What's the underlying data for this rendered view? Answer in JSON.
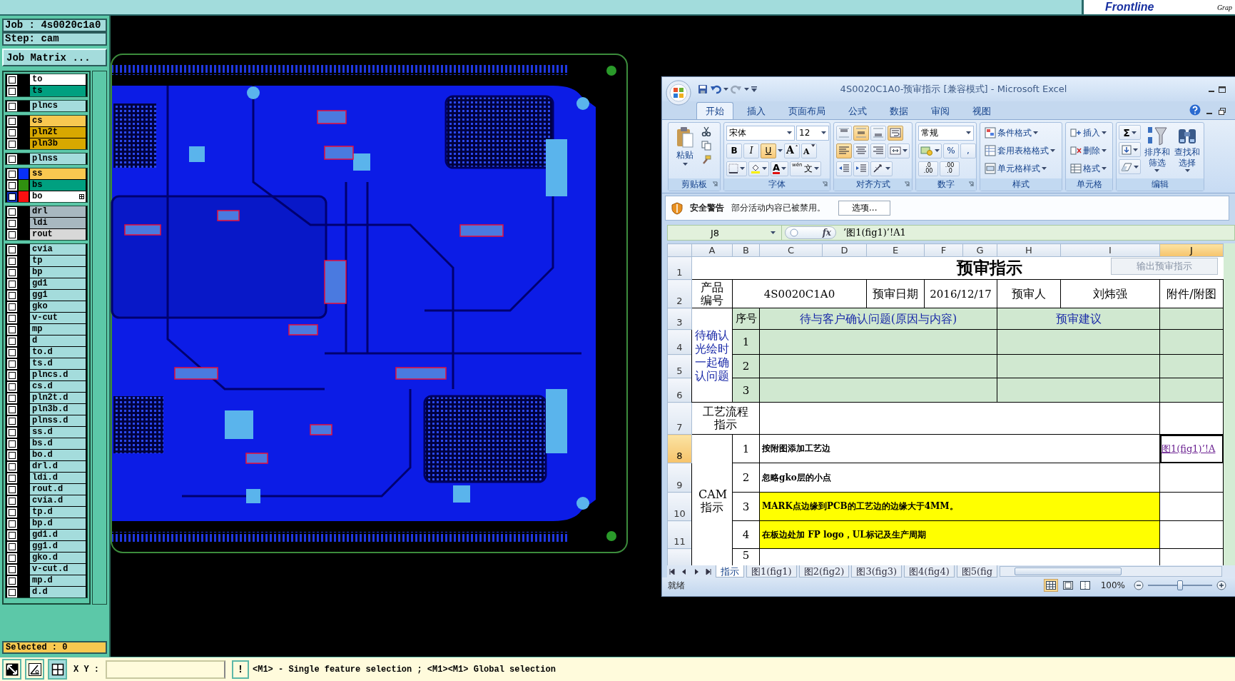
{
  "top_bar": {
    "logo": "Frontline",
    "logo_sub": "Grap"
  },
  "job_panel": {
    "job": "Job : 4s0020c1a0",
    "step": "Step: cam",
    "matrix_button": "Job Matrix ...",
    "selected_count": "Selected : 0"
  },
  "layer_groups": [
    {
      "layers": [
        {
          "name": "to",
          "color": "#ffffff",
          "checked": false,
          "selected": false
        },
        {
          "name": "ts",
          "color": "#00a080",
          "checked": false,
          "selected": false
        }
      ]
    },
    {
      "layers": [
        {
          "name": "plncs",
          "color": "#a4dcdc",
          "checked": false,
          "selected": false
        }
      ]
    },
    {
      "layers": [
        {
          "name": "cs",
          "color": "#f8c850",
          "checked": false,
          "selected": false
        },
        {
          "name": "pln2t",
          "color": "#d8a800",
          "checked": false,
          "selected": false
        },
        {
          "name": "pln3b",
          "color": "#d8a800",
          "checked": false,
          "selected": false
        }
      ]
    },
    {
      "layers": [
        {
          "name": "plnss",
          "color": "#a4dcdc",
          "checked": false,
          "selected": false
        }
      ]
    },
    {
      "layers": [
        {
          "name": "ss",
          "color": "#f8c850",
          "checked": false,
          "selected": false,
          "swatch": {
            "color": "#0830f8"
          }
        },
        {
          "name": "bs",
          "color": "#00a080",
          "checked": false,
          "selected": false,
          "swatch": {
            "color": "#309010"
          }
        },
        {
          "name": "bo",
          "color": "#ffffff",
          "checked": false,
          "selected": true,
          "swatch": {
            "color": "#f81010"
          }
        }
      ]
    },
    {
      "layers": [
        {
          "name": "drl",
          "color": "#a8b8c0",
          "checked": false,
          "selected": false
        },
        {
          "name": "ldi",
          "color": "#a8b8c0",
          "checked": false,
          "selected": false
        },
        {
          "name": "rout",
          "color": "#d8d8d8",
          "checked": false,
          "selected": false
        }
      ]
    },
    {
      "layers": [
        {
          "name": "cvia",
          "color": "#a4dcdc",
          "checked": false,
          "selected": false
        },
        {
          "name": "tp",
          "color": "#a4dcdc",
          "checked": false,
          "selected": false
        },
        {
          "name": "bp",
          "color": "#a4dcdc",
          "checked": false,
          "selected": false
        },
        {
          "name": "gd1",
          "color": "#a4dcdc",
          "checked": false,
          "selected": false
        },
        {
          "name": "gg1",
          "color": "#a4dcdc",
          "checked": false,
          "selected": false
        },
        {
          "name": "gko",
          "color": "#a4dcdc",
          "checked": false,
          "selected": false
        },
        {
          "name": "v-cut",
          "color": "#a4dcdc",
          "checked": false,
          "selected": false
        },
        {
          "name": "mp",
          "color": "#a4dcdc",
          "checked": false,
          "selected": false
        },
        {
          "name": "d",
          "color": "#a4dcdc",
          "checked": false,
          "selected": false
        },
        {
          "name": "to.d",
          "color": "#a4dcdc",
          "checked": false,
          "selected": false
        },
        {
          "name": "ts.d",
          "color": "#a4dcdc",
          "checked": false,
          "selected": false
        },
        {
          "name": "plncs.d",
          "color": "#a4dcdc",
          "checked": false,
          "selected": false
        },
        {
          "name": "cs.d",
          "color": "#a4dcdc",
          "checked": false,
          "selected": false
        },
        {
          "name": "pln2t.d",
          "color": "#a4dcdc",
          "checked": false,
          "selected": false
        },
        {
          "name": "pln3b.d",
          "color": "#a4dcdc",
          "checked": false,
          "selected": false
        },
        {
          "name": "plnss.d",
          "color": "#a4dcdc",
          "checked": false,
          "selected": false
        },
        {
          "name": "ss.d",
          "color": "#a4dcdc",
          "checked": false,
          "selected": false
        },
        {
          "name": "bs.d",
          "color": "#a4dcdc",
          "checked": false,
          "selected": false
        },
        {
          "name": "bo.d",
          "color": "#a4dcdc",
          "checked": false,
          "selected": false
        },
        {
          "name": "drl.d",
          "color": "#a4dcdc",
          "checked": false,
          "selected": false
        },
        {
          "name": "ldi.d",
          "color": "#a4dcdc",
          "checked": false,
          "selected": false
        },
        {
          "name": "rout.d",
          "color": "#a4dcdc",
          "checked": false,
          "selected": false
        },
        {
          "name": "cvia.d",
          "color": "#a4dcdc",
          "checked": false,
          "selected": false
        },
        {
          "name": "tp.d",
          "color": "#a4dcdc",
          "checked": false,
          "selected": false
        },
        {
          "name": "bp.d",
          "color": "#a4dcdc",
          "checked": false,
          "selected": false
        },
        {
          "name": "gd1.d",
          "color": "#a4dcdc",
          "checked": false,
          "selected": false
        },
        {
          "name": "gg1.d",
          "color": "#a4dcdc",
          "checked": false,
          "selected": false
        },
        {
          "name": "gko.d",
          "color": "#a4dcdc",
          "checked": false,
          "selected": false
        },
        {
          "name": "v-cut.d",
          "color": "#a4dcdc",
          "checked": false,
          "selected": false
        },
        {
          "name": "mp.d",
          "color": "#a4dcdc",
          "checked": false,
          "selected": false
        },
        {
          "name": "d.d",
          "color": "#a4dcdc",
          "checked": false,
          "selected": false
        }
      ]
    }
  ],
  "bottom_bar": {
    "xy_label": "X Y :",
    "alert_button": "!",
    "message": "<M1> - Single feature selection ; <M1><M1> Global selection"
  },
  "excel": {
    "title": "4S0020C1A0-预审指示  [兼容模式] - Microsoft Excel",
    "tabs": [
      {
        "label": "开始",
        "selected": true
      },
      {
        "label": "插入",
        "selected": false
      },
      {
        "label": "页面布局",
        "selected": false
      },
      {
        "label": "公式",
        "selected": false
      },
      {
        "label": "数据",
        "selected": false
      },
      {
        "label": "审阅",
        "selected": false
      },
      {
        "label": "视图",
        "selected": false
      }
    ],
    "ribbon": [
      {
        "kind": "clipboard",
        "label": "剪贴板",
        "paste": "粘贴"
      },
      {
        "kind": "font",
        "label": "字体",
        "font_name": "宋体",
        "font_size": "12",
        "styles": [
          {
            "label": "B",
            "selected": false
          },
          {
            "label": "I",
            "selected": false
          },
          {
            "label": "U",
            "selected": true
          }
        ],
        "grow": "A",
        "shrink": "A",
        "font_color": "A",
        "phonetic": {
          "pinyin": "wén",
          "char": "文"
        }
      },
      {
        "kind": "alignment",
        "label": "对齐方式",
        "vertical": [
          {
            "selected": false
          },
          {
            "selected": true
          },
          {
            "selected": false
          }
        ],
        "wrap_text": {
          "selected": true
        },
        "horizontal": [
          {
            "selected": true
          },
          {
            "selected": false
          },
          {
            "selected": false
          }
        ]
      },
      {
        "kind": "number",
        "label": "数字",
        "format": "常规",
        "percent": "%",
        "comma": ",",
        "decimals": [
          {
            "top": ".0",
            "bottom": ".00"
          },
          {
            "top": ".00",
            "bottom": ".0"
          }
        ]
      },
      {
        "kind": "styles",
        "label": "样式",
        "items": [
          "条件格式",
          "套用表格格式",
          "单元格样式"
        ]
      },
      {
        "kind": "cells",
        "label": "单元格",
        "items": [
          "插入",
          "删除",
          "格式"
        ]
      },
      {
        "kind": "editing",
        "label": "编辑",
        "sum": "Σ",
        "sort": "排序和筛选",
        "find": "查找和选择"
      }
    ],
    "security_bar": {
      "title": "安全警告",
      "message": "部分活动内容已被禁用。",
      "button": "选项..."
    },
    "sheet": {
      "name_box": "J8",
      "function_label": "fx",
      "formula": "’图1(fig1)’!A1",
      "columns": [
        {
          "label": "A",
          "selected": false
        },
        {
          "label": "B",
          "selected": false
        },
        {
          "label": "C",
          "selected": false
        },
        {
          "label": "D",
          "selected": false
        },
        {
          "label": "E",
          "selected": false
        },
        {
          "label": "F",
          "selected": false
        },
        {
          "label": "G",
          "selected": false
        },
        {
          "label": "H",
          "selected": false
        },
        {
          "label": "I",
          "selected": false
        },
        {
          "label": "J",
          "selected": true
        }
      ],
      "rows": [
        {
          "label": "1",
          "selected": false
        },
        {
          "label": "2",
          "selected": false
        },
        {
          "label": "3",
          "selected": false
        },
        {
          "label": "4",
          "selected": false
        },
        {
          "label": "5",
          "selected": false
        },
        {
          "label": "6",
          "selected": false
        },
        {
          "label": "7",
          "selected": false
        },
        {
          "label": "8",
          "selected": true
        },
        {
          "label": "9",
          "selected": false
        },
        {
          "label": "10",
          "selected": false
        },
        {
          "label": "11",
          "selected": false
        }
      ],
      "grid": [
        [
          {
            "kind": "title",
            "text": "预审指示",
            "selected": false
          },
          {
            "kind": "span_right"
          },
          {
            "kind": "span_right"
          },
          {
            "kind": "span_right"
          },
          {
            "kind": "span_right"
          },
          {
            "kind": "span_right"
          },
          {
            "kind": "span_right"
          },
          {
            "kind": "span_right"
          },
          {
            "kind": "span_right"
          },
          {
            "kind": "span_right"
          }
        ],
        [
          {
            "kind": "side_label",
            "text": "产品编号",
            "selected": false
          },
          {
            "kind": "value",
            "text": "4S0020C1A0",
            "selected": false
          },
          {
            "kind": "span_right"
          },
          {
            "kind": "span_right"
          },
          {
            "kind": "label",
            "text": "预审日期",
            "selected": false
          },
          {
            "kind": "value",
            "text": "2016/12/17",
            "selected": false
          },
          {
            "kind": "span_right"
          },
          {
            "kind": "label",
            "text": "预审人",
            "selected": false
          },
          {
            "kind": "label",
            "text": "刘炜强",
            "selected": false
          },
          {
            "kind": "label",
            "text": "附件/附图",
            "selected": false
          }
        ],
        [
          {
            "kind": "heading",
            "text": "待确认光绘时一起确认问题",
            "selected": false
          },
          {
            "kind": "number",
            "text": "序号",
            "color": "#d0e8d0",
            "selected": false
          },
          {
            "kind": "heading",
            "text": "待与客户确认问题(原因与内容)",
            "color": "#d0e8d0",
            "selected": false
          },
          {
            "kind": "span_right"
          },
          {
            "kind": "span_right"
          },
          {
            "kind": "span_right"
          },
          {
            "kind": "span_right"
          },
          {
            "kind": "heading",
            "text": "预审建议",
            "color": "#d0e8d0",
            "selected": false
          },
          {
            "kind": "span_right"
          },
          {
            "kind": "blank",
            "color": "#d0e8d0",
            "selected": false
          }
        ],
        [
          {
            "kind": "span_down"
          },
          {
            "kind": "number",
            "text": "1",
            "color": "#d0e8d0",
            "selected": false
          },
          {
            "kind": "blank",
            "color": "#d0e8d0",
            "selected": false
          },
          {
            "kind": "span_right"
          },
          {
            "kind": "span_right"
          },
          {
            "kind": "span_right"
          },
          {
            "kind": "span_right"
          },
          {
            "kind": "blank",
            "color": "#d0e8d0",
            "selected": false
          },
          {
            "kind": "span_right"
          },
          {
            "kind": "blank",
            "color": "#d0e8d0",
            "selected": false
          }
        ],
        [
          {
            "kind": "span_down"
          },
          {
            "kind": "number",
            "text": "2",
            "color": "#d0e8d0",
            "selected": false
          },
          {
            "kind": "blank",
            "color": "#d0e8d0",
            "selected": false
          },
          {
            "kind": "span_right"
          },
          {
            "kind": "span_right"
          },
          {
            "kind": "span_right"
          },
          {
            "kind": "span_right"
          },
          {
            "kind": "blank",
            "color": "#d0e8d0",
            "selected": false
          },
          {
            "kind": "span_right"
          },
          {
            "kind": "blank",
            "color": "#d0e8d0",
            "selected": false
          }
        ],
        [
          {
            "kind": "span_down"
          },
          {
            "kind": "number",
            "text": "3",
            "color": "#d0e8d0",
            "selected": false
          },
          {
            "kind": "blank",
            "color": "#d0e8d0",
            "selected": false
          },
          {
            "kind": "span_right"
          },
          {
            "kind": "span_right"
          },
          {
            "kind": "span_right"
          },
          {
            "kind": "span_right"
          },
          {
            "kind": "blank",
            "color": "#d0e8d0",
            "selected": false
          },
          {
            "kind": "span_right"
          },
          {
            "kind": "blank",
            "color": "#d0e8d0",
            "selected": false
          }
        ],
        [
          {
            "kind": "side_label",
            "text": "工艺流程指示",
            "selected": false
          },
          {
            "kind": "span_right"
          },
          {
            "kind": "blank",
            "selected": false
          },
          {
            "kind": "span_right"
          },
          {
            "kind": "span_right"
          },
          {
            "kind": "span_right"
          },
          {
            "kind": "span_right"
          },
          {
            "kind": "span_right"
          },
          {
            "kind": "span_right"
          },
          {
            "kind": "blank",
            "selected": false
          }
        ],
        [
          {
            "kind": "side_label",
            "text": "CAM指示",
            "selected": false
          },
          {
            "kind": "number",
            "text": "1",
            "selected": false
          },
          {
            "kind": "note",
            "text": "按附图添加工艺边",
            "selected": false
          },
          {
            "kind": "span_right"
          },
          {
            "kind": "span_right"
          },
          {
            "kind": "span_right"
          },
          {
            "kind": "span_right"
          },
          {
            "kind": "span_right"
          },
          {
            "kind": "span_right"
          },
          {
            "kind": "link",
            "text": "图1(fig1)’!A",
            "selected": true
          }
        ],
        [
          {
            "kind": "span_down"
          },
          {
            "kind": "number",
            "text": "2",
            "selected": false
          },
          {
            "kind": "note",
            "text": "忽略gko层的小点",
            "selected": false
          },
          {
            "kind": "span_right"
          },
          {
            "kind": "span_right"
          },
          {
            "kind": "span_right"
          },
          {
            "kind": "span_right"
          },
          {
            "kind": "span_right"
          },
          {
            "kind": "span_right"
          },
          {
            "kind": "blank",
            "selected": false
          }
        ],
        [
          {
            "kind": "span_down"
          },
          {
            "kind": "number",
            "text": "3",
            "selected": false
          },
          {
            "kind": "note",
            "text": "MARK点边缘到PCB的工艺边的边缘大于4MM。",
            "color": "#ffff00",
            "selected": false
          },
          {
            "kind": "span_right"
          },
          {
            "kind": "span_right"
          },
          {
            "kind": "span_right"
          },
          {
            "kind": "span_right"
          },
          {
            "kind": "span_right"
          },
          {
            "kind": "span_right"
          },
          {
            "kind": "blank",
            "selected": false
          }
        ],
        [
          {
            "kind": "span_down"
          },
          {
            "kind": "number",
            "text": "4",
            "selected": false
          },
          {
            "kind": "note",
            "text": "在板边处加 FP logo，UL标记及生产周期",
            "color": "#ffff00",
            "selected": false
          },
          {
            "kind": "span_right"
          },
          {
            "kind": "span_right"
          },
          {
            "kind": "span_right"
          },
          {
            "kind": "span_right"
          },
          {
            "kind": "span_right"
          },
          {
            "kind": "span_right"
          },
          {
            "kind": "blank",
            "selected": false
          }
        ],
        [
          {
            "kind": "span_down"
          },
          {
            "kind": "number",
            "text": "5",
            "selected": false
          },
          {
            "kind": "blank",
            "selected": false
          },
          {
            "kind": "span_right"
          },
          {
            "kind": "span_right"
          },
          {
            "kind": "span_right"
          },
          {
            "kind": "span_right"
          },
          {
            "kind": "span_right"
          },
          {
            "kind": "span_right"
          },
          {
            "kind": "blank",
            "selected": false
          }
        ]
      ],
      "export_button": {
        "label": "输出预审指示",
        "disabled": true
      },
      "sheet_tabs": [
        {
          "label": "指示",
          "selected": true
        },
        {
          "label": "图1(fig1)",
          "selected": false
        },
        {
          "label": "图2(fig2)",
          "selected": false
        },
        {
          "label": "图3(fig3)",
          "selected": false
        },
        {
          "label": "图4(fig4)",
          "selected": false
        },
        {
          "label": "图5(fig",
          "selected": false
        }
      ],
      "status": "就绪",
      "views": [
        {
          "selected": true
        },
        {
          "selected": false
        },
        {
          "selected": false
        }
      ],
      "zoom": "100%",
      "zoom_slider": {
        "level": 0.5
      }
    }
  }
}
